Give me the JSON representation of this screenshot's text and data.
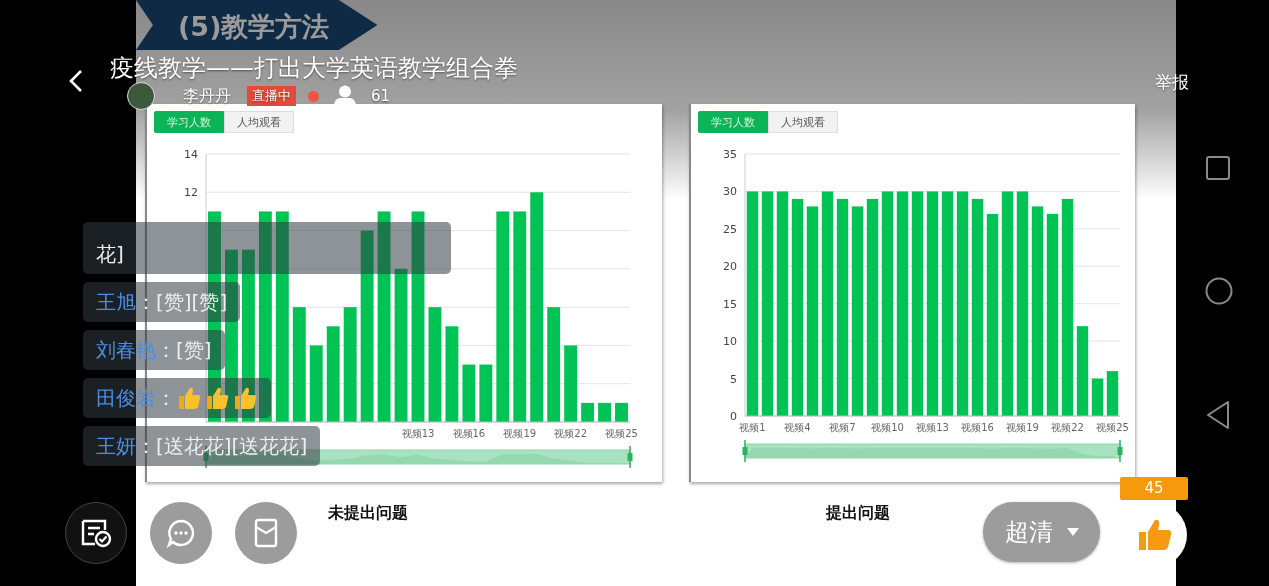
{
  "header": {
    "title": "疫线教学——打出大学英语教学组合拳",
    "host": "李丹丹",
    "live_badge": "直播中",
    "viewers": "61",
    "report": "举报"
  },
  "slide": {
    "banner": "(5)教学方法",
    "panels": [
      {
        "tabs": [
          {
            "label": "学习人数",
            "selected": true
          },
          {
            "label": "人均观看",
            "selected": false
          }
        ],
        "caption": "未提出问题",
        "chart_data": {
          "type": "bar",
          "categories": [
            null,
            null,
            null,
            null,
            null,
            null,
            null,
            null,
            null,
            null,
            null,
            null,
            "视频13",
            null,
            null,
            "视频16",
            null,
            null,
            "视频19",
            null,
            null,
            "视频22",
            null,
            null,
            "视频25"
          ],
          "series": [
            {
              "color": "#00c356",
              "values": [
                11,
                9,
                9,
                11,
                11,
                6,
                4,
                5,
                6,
                10,
                11,
                8,
                11,
                6,
                5,
                3,
                3,
                11,
                11,
                12,
                6,
                4,
                1,
                1,
                1
              ]
            }
          ],
          "ylim": [
            0,
            14
          ],
          "yticks": [
            12,
            14
          ],
          "grid": true
        }
      },
      {
        "tabs": [
          {
            "label": "学习人数",
            "selected": true
          },
          {
            "label": "人均观看",
            "selected": false
          }
        ],
        "caption": "提出问题",
        "chart_data": {
          "type": "bar",
          "categories": [
            "视频1",
            null,
            null,
            "视频4",
            null,
            null,
            "视频7",
            null,
            null,
            "视频10",
            null,
            null,
            "视频13",
            null,
            null,
            "视频16",
            null,
            null,
            "视频19",
            null,
            null,
            "视频22",
            null,
            null,
            "视频25"
          ],
          "series": [
            {
              "color": "#00c356",
              "values": [
                30,
                30,
                30,
                29,
                28,
                30,
                29,
                28,
                29,
                30,
                30,
                30,
                30,
                30,
                30,
                29,
                27,
                30,
                30,
                28,
                27,
                29,
                12,
                5,
                6
              ]
            }
          ],
          "ylim": [
            0,
            35
          ],
          "yticks": [
            0,
            5,
            10,
            15,
            20,
            25,
            30,
            35
          ],
          "grid": true
        }
      }
    ]
  },
  "chat": [
    {
      "kind": "text",
      "text": "花]"
    },
    {
      "kind": "text",
      "name": "王旭",
      "text": "：[赞][赞]"
    },
    {
      "kind": "text",
      "name": "刘春艳",
      "text": "：[赞]"
    },
    {
      "kind": "thumbs",
      "name": "田俊岩",
      "text": "："
    },
    {
      "kind": "text",
      "name": "王妍",
      "text": "：[送花花][送花花]"
    }
  ],
  "controls": {
    "quality": "超清",
    "likes": "45"
  }
}
